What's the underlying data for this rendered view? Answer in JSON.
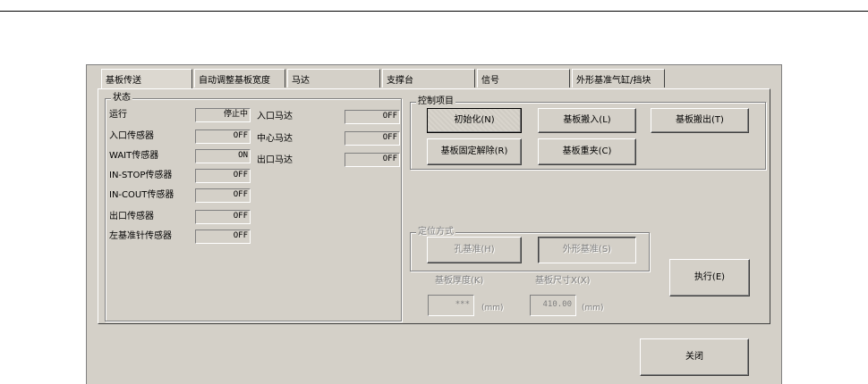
{
  "tabs": [
    "基板传送",
    "自动调整基板宽度",
    "马达",
    "支撑台",
    "信号",
    "外形基准气缸/挡块"
  ],
  "status": {
    "title": "状态",
    "rows": [
      {
        "label": "运行",
        "value": "停止中"
      },
      {
        "label": "入口传感器",
        "value": "OFF"
      },
      {
        "label": "WAIT传感器",
        "value": "ON"
      },
      {
        "label": "IN-STOP传感器",
        "value": "OFF"
      },
      {
        "label": "IN-COUT传感器",
        "value": "OFF"
      },
      {
        "label": "出口传感器",
        "value": "OFF"
      },
      {
        "label": "左基准针传感器",
        "value": "OFF"
      }
    ],
    "motors": [
      {
        "label": "入口马达",
        "value": "OFF"
      },
      {
        "label": "中心马达",
        "value": "OFF"
      },
      {
        "label": "出口马达",
        "value": "OFF"
      }
    ]
  },
  "control": {
    "title": "控制项目",
    "init": "初始化(N)",
    "load": "基板搬入(L)",
    "unload": "基板搬出(T)",
    "release": "基板固定解除(R)",
    "reclamp": "基板重夹(C)"
  },
  "positioning": {
    "title": "定位方式",
    "hole": "孔基准(H)",
    "outline": "外形基准(S)",
    "thickness_label": "基板厚度(K)",
    "thickness_value": "***",
    "thickness_unit": "(mm)",
    "size_label": "基板尺寸X(X)",
    "size_value": "410.00",
    "size_unit": "(mm)"
  },
  "execute": "执行(E)",
  "close": "关闭"
}
